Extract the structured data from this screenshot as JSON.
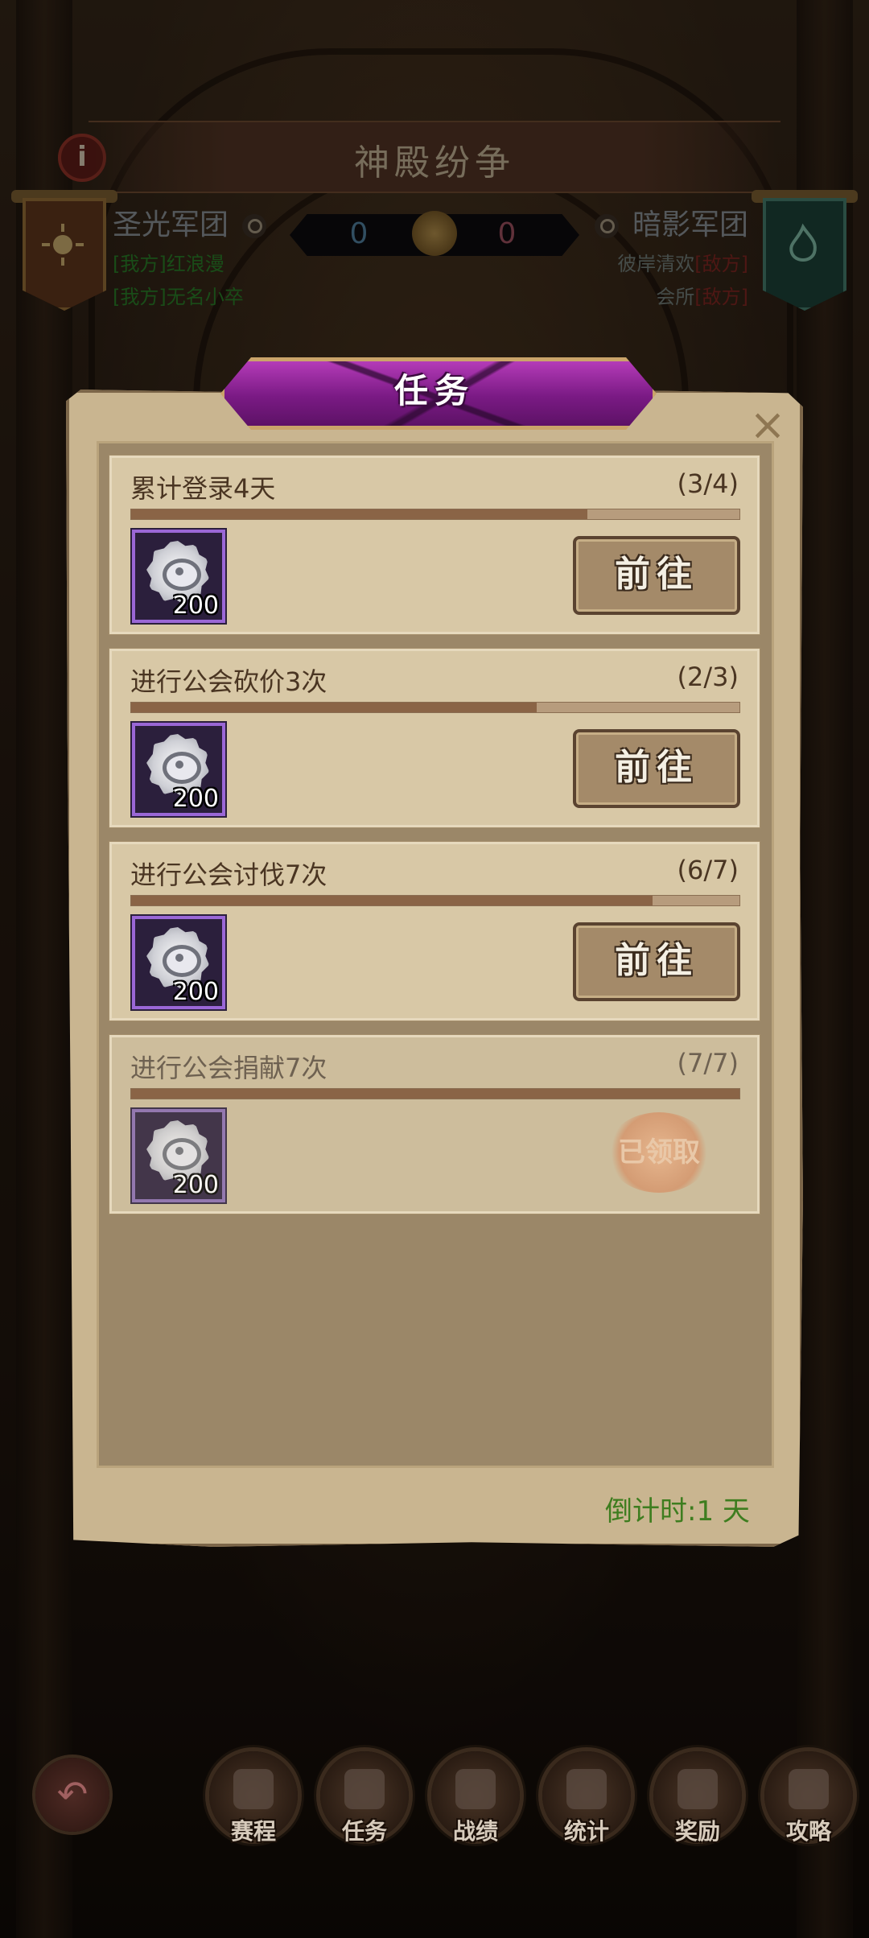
{
  "header": {
    "title": "神殿纷争",
    "info_icon": "info-icon"
  },
  "left_team": {
    "name": "圣光军团",
    "members": [
      {
        "tag": "[我方]",
        "name": "红浪漫"
      },
      {
        "tag": "[我方]",
        "name": "无名小卒"
      }
    ],
    "score": "0"
  },
  "right_team": {
    "name": "暗影军团",
    "members": [
      {
        "tag": "[敌方]",
        "name": "彼岸清欢"
      },
      {
        "tag": "[敌方]",
        "name": "会所"
      }
    ],
    "score": "0"
  },
  "panel": {
    "title": "任务",
    "close_icon": "close-icon",
    "countdown": "倒计时:1 天"
  },
  "tasks": [
    {
      "name": "累计登录4天",
      "progress_text": "(3/4)",
      "progress": 0.75,
      "reward_amount": "200",
      "button": "前往",
      "done": false
    },
    {
      "name": "进行公会砍价3次",
      "progress_text": "(2/3)",
      "progress": 0.6667,
      "reward_amount": "200",
      "button": "前往",
      "done": false
    },
    {
      "name": "进行公会讨伐7次",
      "progress_text": "(6/7)",
      "progress": 0.857,
      "reward_amount": "200",
      "button": "前往",
      "done": false
    },
    {
      "name": "进行公会捐献7次",
      "progress_text": "(7/7)",
      "progress": 1.0,
      "reward_amount": "200",
      "status": "已领取",
      "done": true
    }
  ],
  "bottom_nav": {
    "back_icon": "back-arrow-icon",
    "items": [
      {
        "label": "赛程",
        "icon": "schedule-icon"
      },
      {
        "label": "任务",
        "icon": "task-icon"
      },
      {
        "label": "战绩",
        "icon": "record-icon"
      },
      {
        "label": "统计",
        "icon": "stats-icon"
      },
      {
        "label": "奖励",
        "icon": "reward-chest-icon"
      },
      {
        "label": "攻略",
        "icon": "guide-book-icon"
      }
    ]
  }
}
